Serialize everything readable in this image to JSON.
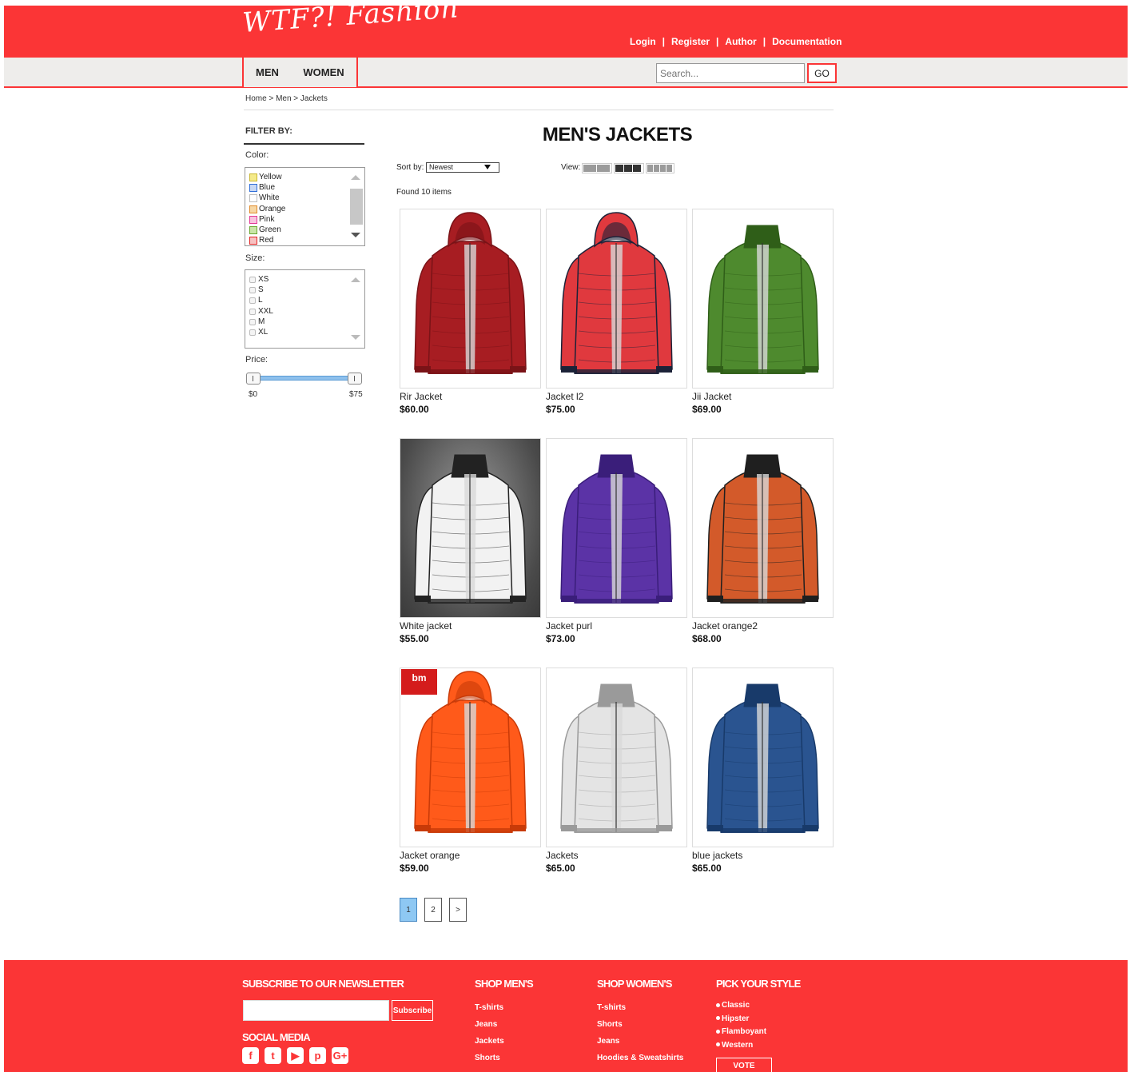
{
  "brand": {
    "logo": "WTF?! Fashion",
    "accent": "#fb3536"
  },
  "top_links": [
    "Login",
    "Register",
    "Author",
    "Documentation"
  ],
  "nav": {
    "tabs": [
      "MEN",
      "WOMEN"
    ],
    "search_placeholder": "Search...",
    "go_label": "GO"
  },
  "breadcrumb": "Home > Men > Jackets",
  "filter": {
    "title": "FILTER BY:",
    "color_label": "Color:",
    "colors": [
      {
        "name": "Yellow",
        "fill": "#f4ea8a",
        "border": "#c9b733"
      },
      {
        "name": "Blue",
        "fill": "#c8d8f4",
        "border": "#2f6ed8"
      },
      {
        "name": "White",
        "fill": "#ffffff",
        "border": "#bbbbbb"
      },
      {
        "name": "Orange",
        "fill": "#f7d7a4",
        "border": "#e08a2a"
      },
      {
        "name": "Pink",
        "fill": "#f8c4df",
        "border": "#e23a96"
      },
      {
        "name": "Green",
        "fill": "#c9e6a8",
        "border": "#6aa832"
      },
      {
        "name": "Red",
        "fill": "#f7c1c1",
        "border": "#e02424"
      }
    ],
    "size_label": "Size:",
    "sizes": [
      "XS",
      "S",
      "L",
      "XXL",
      "M",
      "XL"
    ],
    "price_label": "Price:",
    "price_min": "$0",
    "price_max": "$75"
  },
  "main": {
    "title": "MEN'S JACKETS",
    "sort_label": "Sort by:",
    "sort_value": "Newest",
    "view_label": "View:",
    "found": "Found 10 items"
  },
  "products": [
    {
      "name": "Rir Jacket",
      "price": "$60.00",
      "color": "#a71d22",
      "shade": "#7a1317",
      "hood": true,
      "dark_bg": false
    },
    {
      "name": "Jacket l2",
      "price": "$75.00",
      "color": "#e0393e",
      "shade": "#1c2238",
      "hood": true,
      "dark_bg": false
    },
    {
      "name": "Jii Jacket",
      "price": "$69.00",
      "color": "#4e8a2e",
      "shade": "#2f5e18",
      "hood": false,
      "dark_bg": false
    },
    {
      "name": "White jacket",
      "price": "$55.00",
      "color": "#f2f2f2",
      "shade": "#222222",
      "hood": false,
      "dark_bg": true
    },
    {
      "name": "Jacket purl",
      "price": "$73.00",
      "color": "#5b33a6",
      "shade": "#3a1e7a",
      "hood": false,
      "dark_bg": false
    },
    {
      "name": "Jacket orange2",
      "price": "$68.00",
      "color": "#d35a2a",
      "shade": "#1f1f1f",
      "hood": false,
      "dark_bg": false
    },
    {
      "name": "Jacket orange",
      "price": "$59.00",
      "color": "#ff5a1a",
      "shade": "#c83a08",
      "hood": true,
      "dark_bg": false,
      "badge": "bm"
    },
    {
      "name": "Jackets",
      "price": "$65.00",
      "color": "#e4e4e4",
      "shade": "#9a9a9a",
      "hood": false,
      "dark_bg": false
    },
    {
      "name": "blue jackets",
      "price": "$65.00",
      "color": "#2a5490",
      "shade": "#183a6a",
      "hood": false,
      "dark_bg": false
    }
  ],
  "pagination": [
    "1",
    "2",
    ">"
  ],
  "footer": {
    "newsletter_title": "SUBSCRIBE TO OUR NEWSLETTER",
    "subscribe_label": "Subscribe",
    "social_title": "SOCIAL MEDIA",
    "social_icons": [
      {
        "name": "facebook-icon",
        "glyph": "f"
      },
      {
        "name": "twitter-icon",
        "glyph": "t"
      },
      {
        "name": "youtube-icon",
        "glyph": "▶"
      },
      {
        "name": "pinterest-icon",
        "glyph": "p"
      },
      {
        "name": "googleplus-icon",
        "glyph": "G+"
      }
    ],
    "shop_men_title": "SHOP MEN'S",
    "shop_men": [
      "T-shirts",
      "Jeans",
      "Jackets",
      "Shorts"
    ],
    "shop_women_title": "SHOP WOMEN'S",
    "shop_women": [
      "T-shirts",
      "Shorts",
      "Jeans",
      "Hoodies & Sweatshirts"
    ],
    "style_title": "PICK YOUR STYLE",
    "styles": [
      "Classic",
      "Hipster",
      "Flamboyant",
      "Western"
    ],
    "vote_label": "VOTE"
  }
}
